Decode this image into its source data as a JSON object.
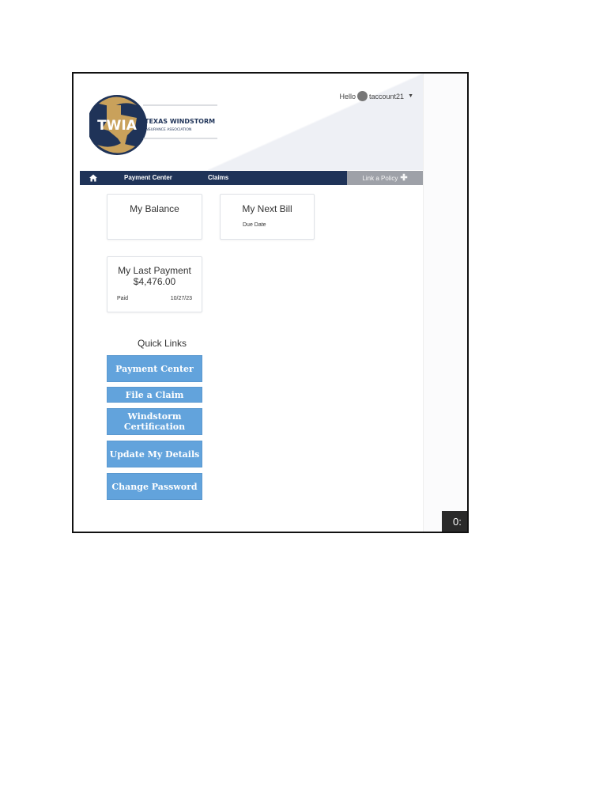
{
  "header": {
    "logo_abbr": "TWIA",
    "logo_line1": "TEXAS WINDSTORM",
    "logo_line2": "INSURANCE ASSOCIATION",
    "greeting": "Hello",
    "username": "taccount21"
  },
  "nav": {
    "home_icon": "home-icon",
    "payment_center": "Payment Center",
    "claims": "Claims",
    "link_policy": "Link a Policy",
    "link_policy_icon": "plus-icon"
  },
  "cards": {
    "balance_title": "My Balance",
    "next_bill_title": "My Next Bill",
    "due_date_label": "Due Date",
    "last_payment_title": "My Last Payment",
    "last_payment_amount": "$4,476.00",
    "paid_label": "Paid",
    "paid_date": "10/27/23"
  },
  "quick_links": {
    "title": "Quick Links",
    "items": [
      "Payment Center",
      "File a Claim",
      "Windstorm Certification",
      "Update My Details",
      "Change Password"
    ]
  },
  "video": {
    "timestamp": "0:"
  },
  "colors": {
    "nav_bg": "#1f3358",
    "quick_link_bg": "#62a3dc",
    "link_policy_bg": "#9ea1a8",
    "logo_gold": "#c9a15b",
    "logo_navy": "#1f3358"
  }
}
